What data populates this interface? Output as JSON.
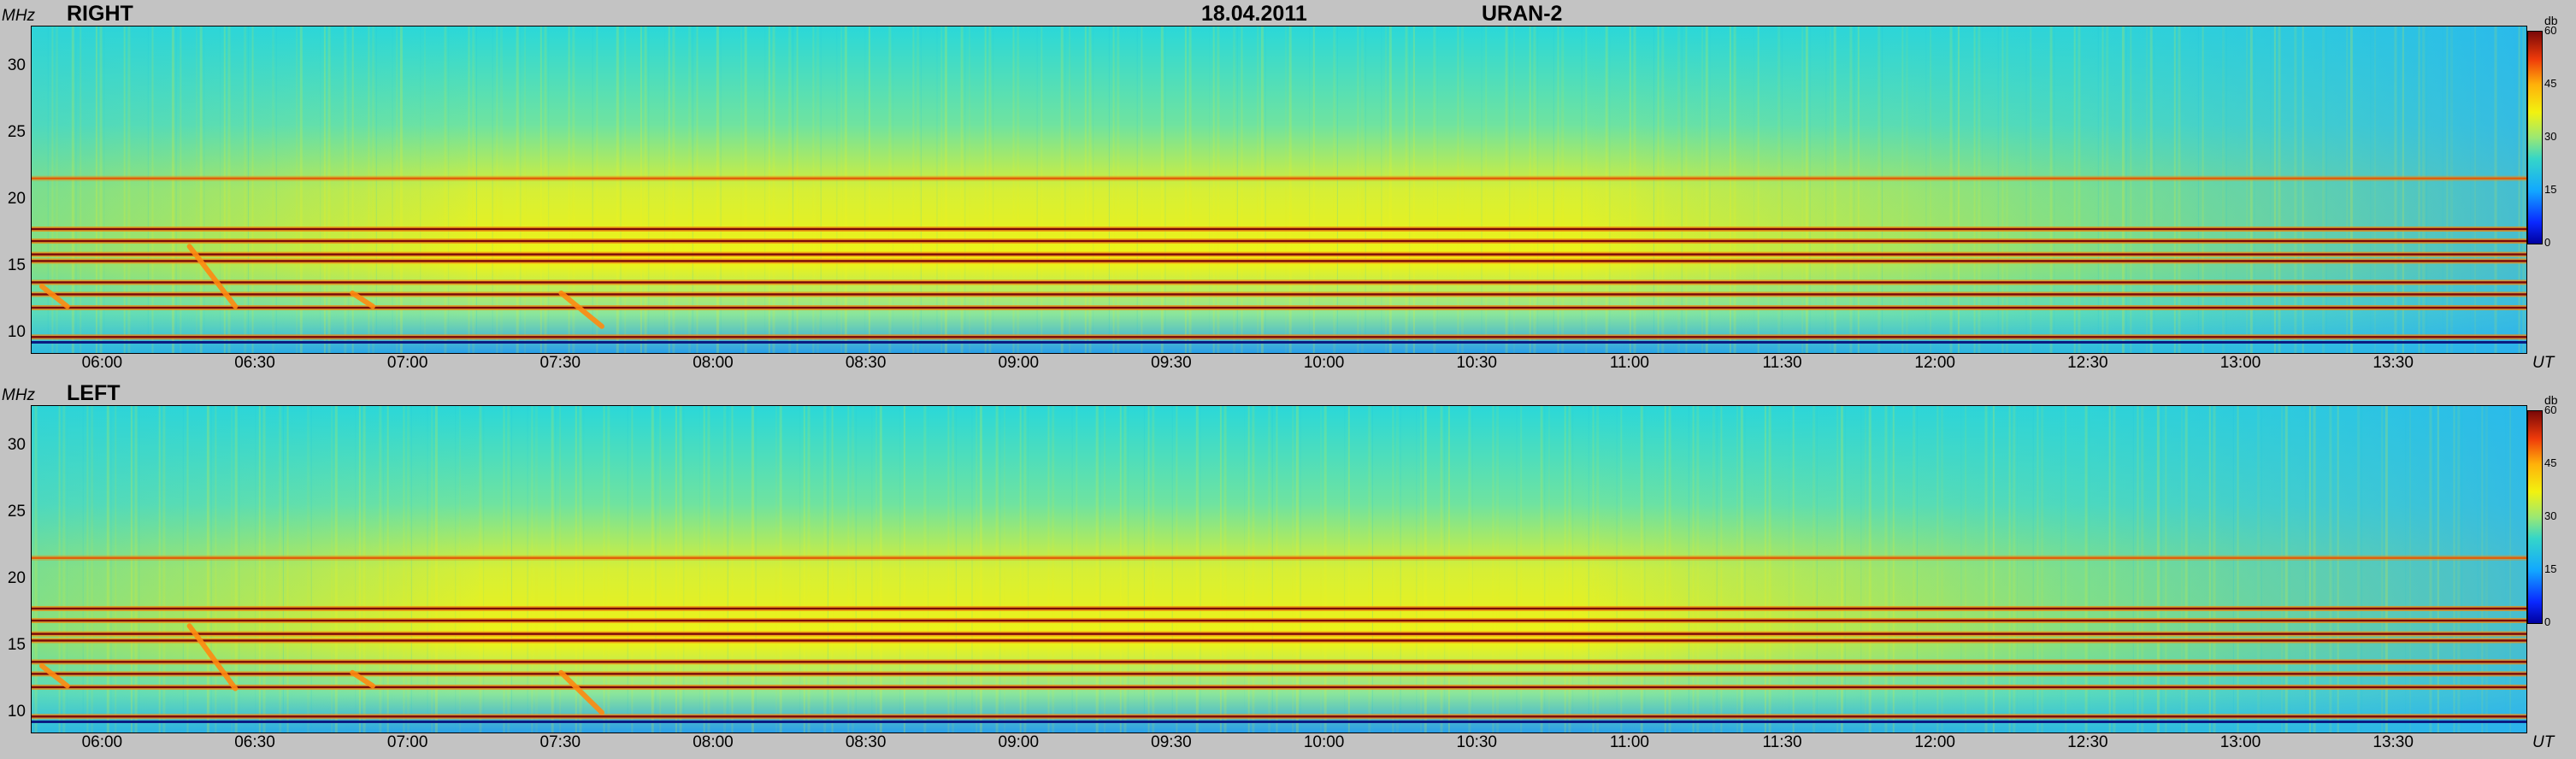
{
  "header": {
    "date": "18.04.2011",
    "station": "URAN-2"
  },
  "colorbar": {
    "title": "db",
    "ticks": [
      "60",
      "45",
      "30",
      "15",
      "0"
    ],
    "stops": [
      "#0000a0",
      "#0a28ff",
      "#12a8ff",
      "#35d6c8",
      "#9be873",
      "#f2f20f",
      "#ffb10a",
      "#ef3a0a",
      "#7a0808"
    ]
  },
  "axes": {
    "y_unit": "MHz",
    "x_unit": "UT"
  },
  "chart_data": [
    {
      "type": "heatmap",
      "title": "RIGHT",
      "x_ticks": [
        "06:00",
        "06:30",
        "07:00",
        "07:30",
        "08:00",
        "08:30",
        "09:00",
        "09:30",
        "10:00",
        "10:30",
        "11:00",
        "11:30",
        "12:00",
        "12:30",
        "13:00",
        "13:30"
      ],
      "y_ticks": [
        "30",
        "25",
        "20",
        "15",
        "10"
      ],
      "ylim": [
        8.5,
        33
      ],
      "xlim": [
        "05:46",
        "13:56"
      ],
      "colorbar_range_db": [
        0,
        60
      ],
      "interference_lines_mhz": [
        9.7,
        11.9,
        12.9,
        13.8,
        15.4,
        15.9,
        16.9,
        17.8,
        21.6
      ],
      "bursts": [
        {
          "start": "05:48",
          "end": "05:53",
          "f_high": 13.5,
          "f_low": 12.0
        },
        {
          "start": "06:17",
          "end": "06:26",
          "f_high": 16.5,
          "f_low": 12.0
        },
        {
          "start": "06:49",
          "end": "06:53",
          "f_high": 13.0,
          "f_low": 12.0
        },
        {
          "start": "07:30",
          "end": "07:38",
          "f_high": 13.0,
          "f_low": 10.5
        }
      ]
    },
    {
      "type": "heatmap",
      "title": "LEFT",
      "x_ticks": [
        "06:00",
        "06:30",
        "07:00",
        "07:30",
        "08:00",
        "08:30",
        "09:00",
        "09:30",
        "10:00",
        "10:30",
        "11:00",
        "11:30",
        "12:00",
        "12:30",
        "13:00",
        "13:30"
      ],
      "y_ticks": [
        "30",
        "25",
        "20",
        "15",
        "10"
      ],
      "ylim": [
        8.5,
        33
      ],
      "xlim": [
        "05:46",
        "13:56"
      ],
      "colorbar_range_db": [
        0,
        60
      ],
      "interference_lines_mhz": [
        9.7,
        11.9,
        12.9,
        13.8,
        15.4,
        15.9,
        16.9,
        17.8,
        21.6
      ],
      "bursts": [
        {
          "start": "05:48",
          "end": "05:53",
          "f_high": 13.5,
          "f_low": 12.0
        },
        {
          "start": "06:17",
          "end": "06:26",
          "f_high": 16.5,
          "f_low": 11.8
        },
        {
          "start": "06:49",
          "end": "06:53",
          "f_high": 13.0,
          "f_low": 12.0
        },
        {
          "start": "07:30",
          "end": "07:38",
          "f_high": 13.0,
          "f_low": 10.0
        }
      ]
    }
  ]
}
